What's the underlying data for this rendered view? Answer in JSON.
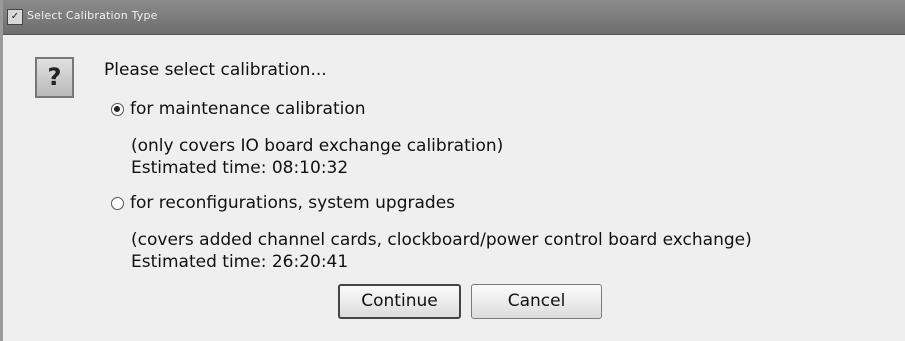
{
  "window": {
    "title": "Select Calibration Type",
    "title_icon": "window-menu-icon"
  },
  "dialog": {
    "icon": "question-icon",
    "icon_glyph": "?",
    "prompt": "Please select calibration...",
    "options": [
      {
        "label": "for maintenance calibration",
        "selected": true,
        "description": "(only covers IO board exchange calibration)",
        "estimate": "Estimated time: 08:10:32"
      },
      {
        "label": "for reconfigurations, system upgrades",
        "selected": false,
        "description": "(covers added channel cards, clockboard/power control board exchange)",
        "estimate": "Estimated time: 26:20:41"
      }
    ],
    "buttons": {
      "continue": "Continue",
      "cancel": "Cancel"
    }
  }
}
